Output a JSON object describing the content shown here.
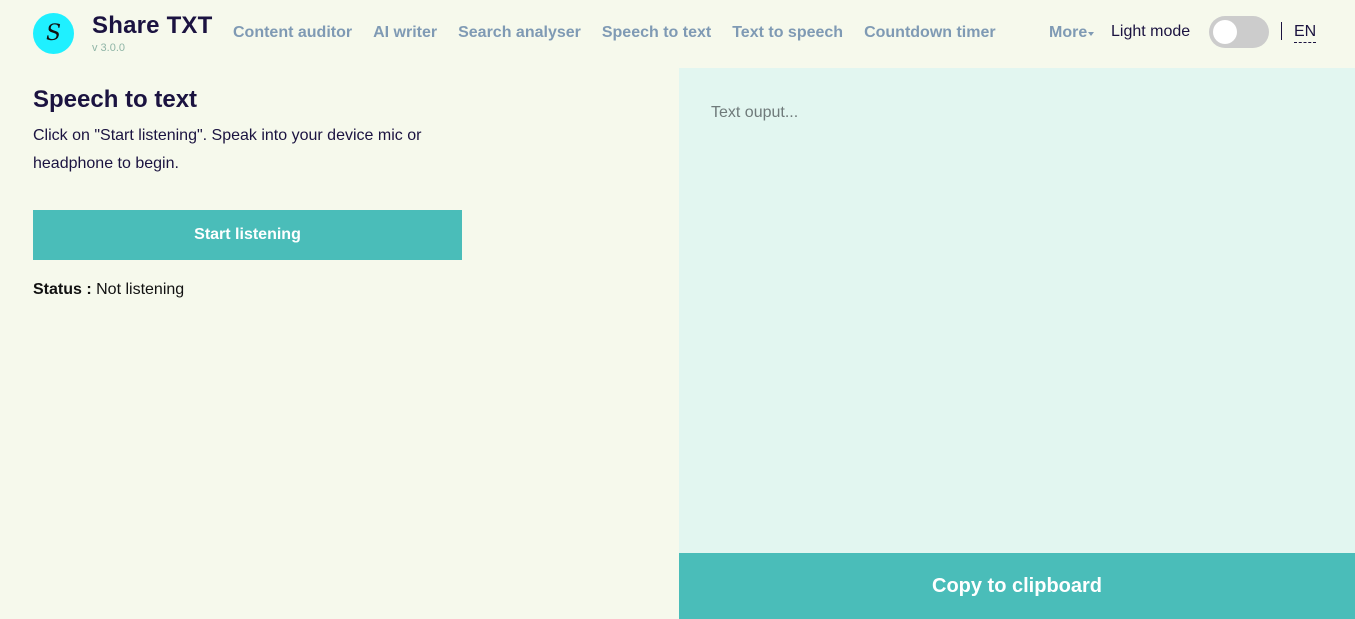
{
  "header": {
    "logo_letter": "S",
    "brand": "Share TXT",
    "version": "v 3.0.0",
    "nav": [
      {
        "label": "Content auditor"
      },
      {
        "label": "AI writer"
      },
      {
        "label": "Search analyser"
      },
      {
        "label": "Speech to text"
      },
      {
        "label": "Text to speech"
      },
      {
        "label": "Countdown timer"
      }
    ],
    "more_label": "More",
    "mode_label": "Light mode",
    "mode_toggle_on": false,
    "language": "EN"
  },
  "main": {
    "title": "Speech to text",
    "instructions": "Click on \"Start listening\". Speak into your device mic or headphone to begin.",
    "start_button": "Start listening",
    "status_label": "Status :",
    "status_value": "Not listening"
  },
  "output": {
    "placeholder": "Text ouput...",
    "copy_button": "Copy to clipboard"
  },
  "colors": {
    "background": "#f6f9ec",
    "accent": "#4abdb9",
    "output_bg": "#e2f6f0",
    "logo": "#1ff0ff",
    "nav_text": "#7f9ab4",
    "heading": "#1b1340"
  }
}
